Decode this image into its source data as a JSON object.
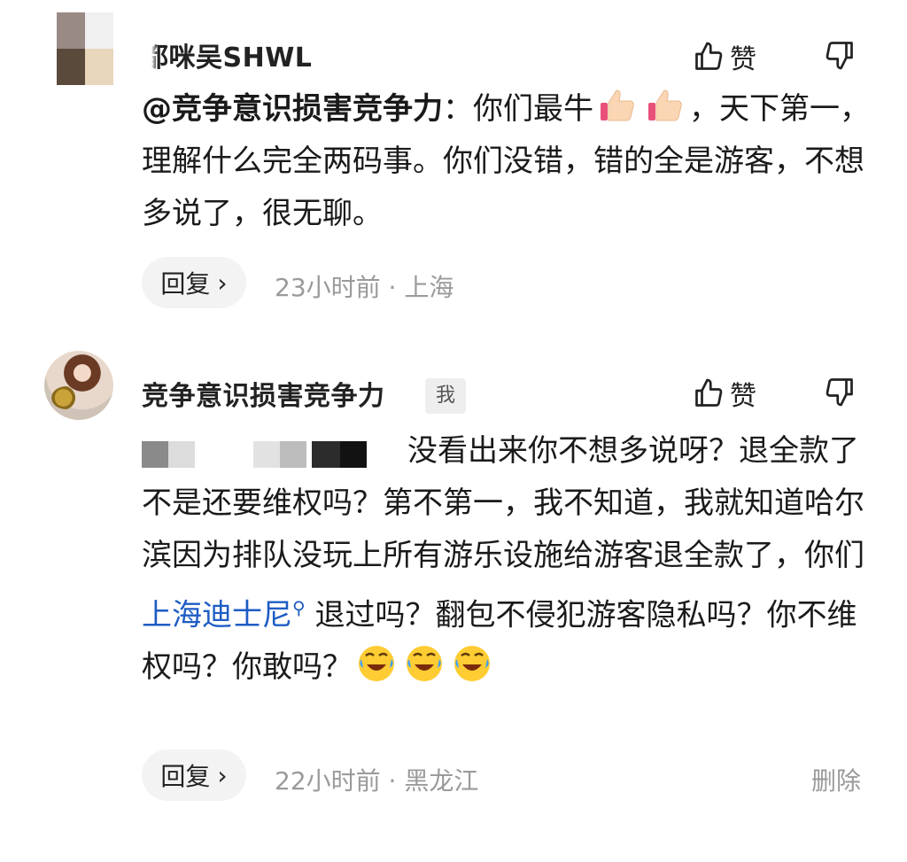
{
  "comments": [
    {
      "username": "都咪吴SHWL",
      "like_label": "赞",
      "mention": "@竞争意识损害竞争力",
      "text": "：你们最牛",
      "text_after": "，天下第一，理解什么完全两码事。你们没错，错的全是游客，不想多说了，很无聊。",
      "emojis": [
        "thumbs-up-emoji",
        "thumbs-up-emoji"
      ],
      "reply_label": "回复",
      "reply_chevron": "›",
      "time": "23小时前",
      "separator": "·",
      "location": "上海"
    },
    {
      "username": "竞争意识损害竞争力",
      "me_badge": "我",
      "like_label": "赞",
      "text_before": "没看出来你不想多说呀？退全款了不是还要维权吗？第不第一，我不知道，我就知道哈尔滨因为排队没玩上所有游乐设施给游客退全款了，你们",
      "link_text": "上海迪士尼",
      "text_after": "退过吗？翻包不侵犯游客隐私吗？你不维权吗？你敢吗？",
      "emojis": [
        "rolling-laugh-emoji",
        "rolling-laugh-emoji",
        "rolling-laugh-emoji"
      ],
      "reply_label": "回复",
      "reply_chevron": "›",
      "time": "22小时前",
      "separator": "·",
      "location": "黑龙江",
      "delete_label": "删除"
    }
  ],
  "colors": {
    "link": "#1e5cc4",
    "meta": "#9a9a9a",
    "reply_bg": "#f3f3f3"
  }
}
